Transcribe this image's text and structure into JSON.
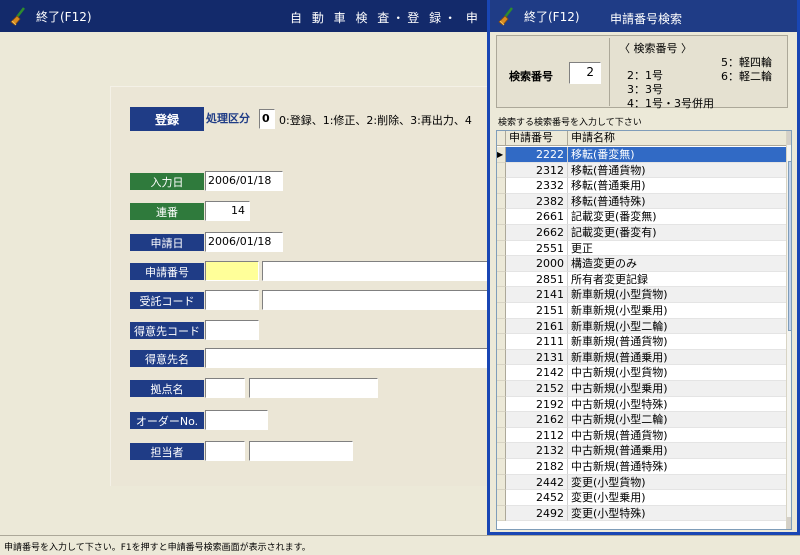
{
  "main": {
    "exit_label": "終了(F12)",
    "title": "自 動 車 検 査・登 録・ 申 請 入",
    "register_label": "登録",
    "kubun_label": "処理区分",
    "kubun_value": "0",
    "kubun_help": "0:登録、1:修正、2:削除、3:再出力、4",
    "fields": {
      "input_date_label": "入力日",
      "input_date_value": "2006/01/18",
      "serial_label": "連番",
      "serial_value": "14",
      "apply_date_label": "申請日",
      "apply_date_value": "2006/01/18",
      "apply_no_label": "申請番号",
      "apply_no_value": "",
      "consign_code_label": "受託コード",
      "customer_code_label": "得意先コード",
      "customer_name_label": "得意先名",
      "base_name_label": "拠点名",
      "order_no_label": "オーダーNo.",
      "staff_label": "担当者"
    }
  },
  "status_text": "申請番号を入力して下さい。F1を押すと申請番号検索画面が表示されます。",
  "popup": {
    "exit_label": "終了(F12)",
    "title": "申請番号検索",
    "search_label": "検索番号",
    "search_value": "2",
    "help_title": "〈 検索番号 〉",
    "help_items": [
      "2：1号",
      "3：3号",
      "4：1号・3号併用",
      "5：軽四輪",
      "6：軽二輪"
    ],
    "hint": "検索する検索番号を入力して下さい",
    "grid": {
      "headers": [
        "申請番号",
        "申請名称"
      ],
      "rows": [
        {
          "code": "2222",
          "name": "移転(番変無)"
        },
        {
          "code": "2312",
          "name": "移転(普通貨物)"
        },
        {
          "code": "2332",
          "name": "移転(普通乗用)"
        },
        {
          "code": "2382",
          "name": "移転(普通特殊)"
        },
        {
          "code": "2661",
          "name": "記載変更(番変無)"
        },
        {
          "code": "2662",
          "name": "記載変更(番変有)"
        },
        {
          "code": "2551",
          "name": "更正"
        },
        {
          "code": "2000",
          "name": "構造変更のみ"
        },
        {
          "code": "2851",
          "name": "所有者変更記録"
        },
        {
          "code": "2141",
          "name": "新車新規(小型貨物)"
        },
        {
          "code": "2151",
          "name": "新車新規(小型乗用)"
        },
        {
          "code": "2161",
          "name": "新車新規(小型二輪)"
        },
        {
          "code": "2111",
          "name": "新車新規(普通貨物)"
        },
        {
          "code": "2131",
          "name": "新車新規(普通乗用)"
        },
        {
          "code": "2142",
          "name": "中古新規(小型貨物)"
        },
        {
          "code": "2152",
          "name": "中古新規(小型乗用)"
        },
        {
          "code": "2192",
          "name": "中古新規(小型特殊)"
        },
        {
          "code": "2162",
          "name": "中古新規(小型二輪)"
        },
        {
          "code": "2112",
          "name": "中古新規(普通貨物)"
        },
        {
          "code": "2132",
          "name": "中古新規(普通乗用)"
        },
        {
          "code": "2182",
          "name": "中古新規(普通特殊)"
        },
        {
          "code": "2442",
          "name": "変更(小型貨物)"
        },
        {
          "code": "2452",
          "name": "変更(小型乗用)"
        },
        {
          "code": "2492",
          "name": "変更(小型特殊)"
        }
      ]
    }
  },
  "colors": {
    "titlebar": "#132a6b",
    "label_blue": "#1f3c86",
    "label_green": "#2f7a3c",
    "highlight": "#ffff99",
    "selection": "#316ac5"
  },
  "icons": {
    "exit": "broom-icon",
    "row_pointer": "row-pointer-icon"
  }
}
